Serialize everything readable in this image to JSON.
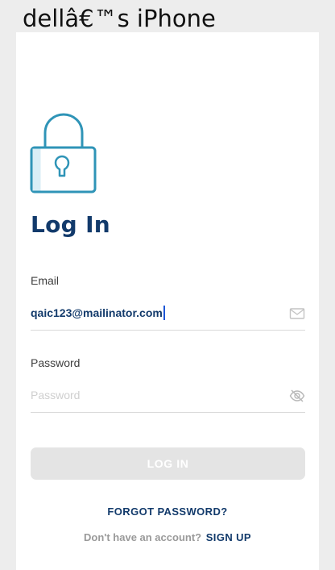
{
  "window": {
    "title": "dellâ€™s iPhone"
  },
  "login": {
    "title": "Log In",
    "email_label": "Email",
    "email_value": "qaic123@mailinator.com",
    "password_label": "Password",
    "password_placeholder": "Password",
    "login_button_label": "LOG IN",
    "forgot_password_label": "FORGOT PASSWORD?",
    "signup_prompt": "Don't have an account?",
    "signup_link_label": "SIGN UP"
  },
  "icons": {
    "lock": "lock-icon",
    "email": "envelope-icon",
    "password_visibility": "eye-off-icon"
  },
  "colors": {
    "brand_navy": "#123a6b",
    "lock_accent": "#2f94b7",
    "button_disabled": "#e4e4e4",
    "background": "#ededed"
  }
}
